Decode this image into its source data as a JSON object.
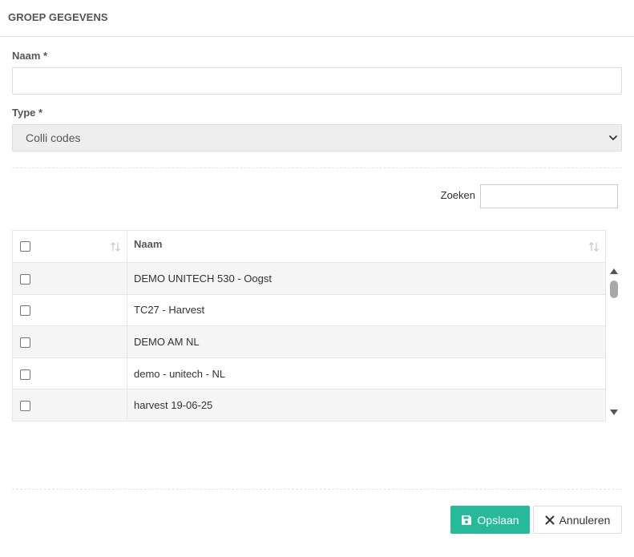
{
  "header": {
    "title": "GROEP GEGEVENS"
  },
  "form": {
    "naam_label": "Naam *",
    "naam_value": "",
    "type_label": "Type *",
    "type_selected": "Colli codes"
  },
  "search": {
    "label": "Zoeken",
    "value": ""
  },
  "table": {
    "column_name": "Naam",
    "rows": [
      {
        "name": "DEMO UNITECH 530 - Oogst",
        "checked": false
      },
      {
        "name": "TC27 - Harvest",
        "checked": false
      },
      {
        "name": "DEMO AM NL",
        "checked": false
      },
      {
        "name": "demo - unitech - NL",
        "checked": false
      },
      {
        "name": "harvest 19-06-25",
        "checked": false
      },
      {
        "name": "",
        "checked": false
      }
    ]
  },
  "buttons": {
    "save_label": "Opslaan",
    "cancel_label": "Annuleren"
  },
  "colors": {
    "accent": "#26b99a",
    "row_stripe": "#f5f5f5",
    "border": "#e5e5e5"
  },
  "icons": {
    "save": "floppy-disk-icon",
    "cancel": "close-icon",
    "sort": "sort-arrows-icon",
    "select": "chevron-down-icon"
  }
}
